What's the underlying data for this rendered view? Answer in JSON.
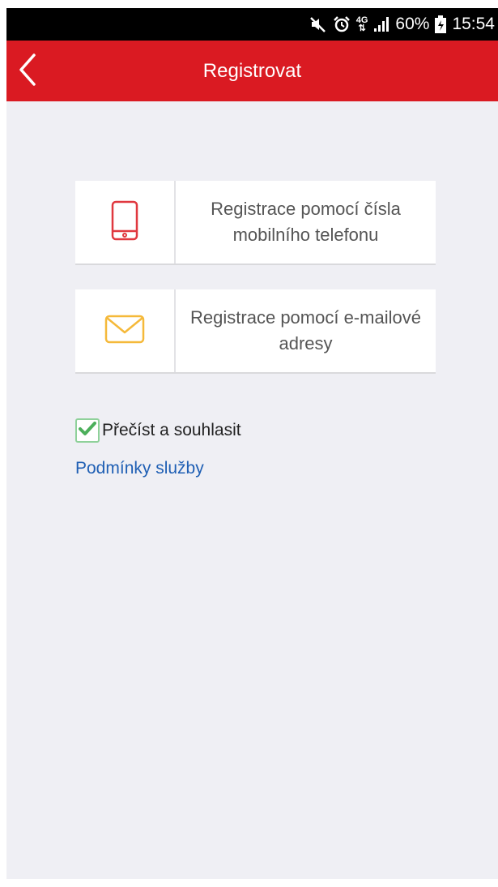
{
  "status_bar": {
    "network": "4G",
    "battery": "60%",
    "time": "15:54",
    "icons": [
      "mute-icon",
      "alarm-icon",
      "network-4g-icon",
      "signal-icon",
      "battery-icon"
    ]
  },
  "app_bar": {
    "title": "Registrovat",
    "back_icon": "chevron-left-icon",
    "color": "#da1a22"
  },
  "options": [
    {
      "label": "Registrace pomocí čísla mobilního telefonu",
      "icon": "mobile-phone-icon",
      "icon_color": "#e0383f"
    },
    {
      "label": "Registrace pomocí e-mailové adresy",
      "icon": "envelope-icon",
      "icon_color": "#f5b93a"
    }
  ],
  "agreement": {
    "checked": true,
    "label": "Přečíst a souhlasit",
    "check_color": "#4caf5b"
  },
  "terms_link": {
    "label": "Podmínky služby",
    "color": "#1f5fb4"
  }
}
